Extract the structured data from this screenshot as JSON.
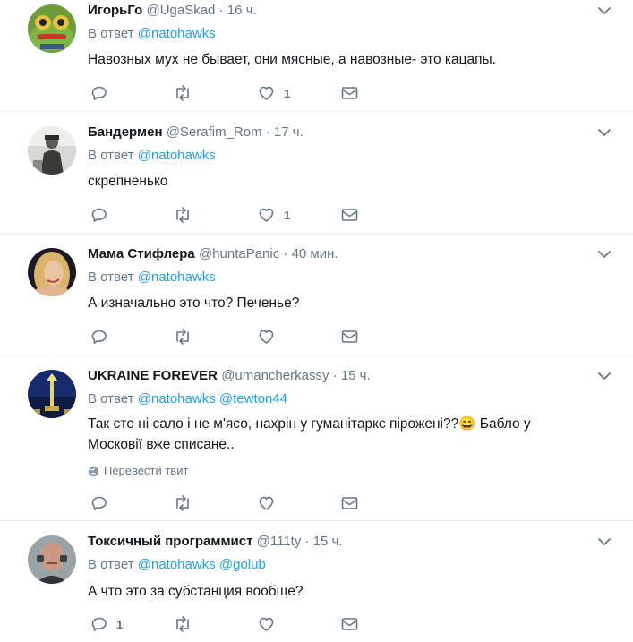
{
  "tweets": [
    {
      "name": "ИгорьГо",
      "handle": "@UgaSkad",
      "time": "16 ч.",
      "reply_prefix": "В ответ",
      "mentions": [
        "@natohawks"
      ],
      "text": "Навозных мух не бывает, они мясные, а навозные- это кацапы.",
      "translate": "",
      "counts": {
        "reply": "",
        "retweet": "",
        "like": "1"
      },
      "avatar": "frog-avatar"
    },
    {
      "name": "Бандермен",
      "handle": "@Serafim_Rom",
      "time": "17 ч.",
      "reply_prefix": "В ответ",
      "mentions": [
        "@natohawks"
      ],
      "text": "скрепненько",
      "translate": "",
      "counts": {
        "reply": "",
        "retweet": "",
        "like": "1"
      },
      "avatar": "vintage-photo-avatar"
    },
    {
      "name": "Мама Стифлера",
      "handle": "@huntaPanic",
      "time": "40 мин.",
      "reply_prefix": "В ответ",
      "mentions": [
        "@natohawks"
      ],
      "text": "А изначально это что? Печенье?",
      "translate": "",
      "counts": {
        "reply": "",
        "retweet": "",
        "like": ""
      },
      "avatar": "woman-portrait-avatar"
    },
    {
      "name": "UKRAINE FOREVER",
      "handle": "@umancherkassy",
      "time": "15 ч.",
      "reply_prefix": "В ответ",
      "mentions": [
        "@natohawks",
        "@tewton44"
      ],
      "text": "Так єто ні сало і не м'ясо, нахрін у гуманітаркє пірожені??😄 Бабло у Московії вже списане..",
      "translate": "Перевести твит",
      "counts": {
        "reply": "",
        "retweet": "",
        "like": ""
      },
      "avatar": "monument-night-avatar"
    },
    {
      "name": "Токсичный программист",
      "handle": "@111ty",
      "time": "15 ч.",
      "reply_prefix": "В ответ",
      "mentions": [
        "@natohawks",
        "@golub"
      ],
      "text": "А что это за субстанция вообще?",
      "translate": "",
      "counts": {
        "reply": "1",
        "retweet": "",
        "like": ""
      },
      "avatar": "bald-man-avatar"
    }
  ],
  "colors": {
    "text": "#14171a",
    "muted": "#657786",
    "link": "#1da1f2",
    "separator": "#e6ecf0"
  }
}
